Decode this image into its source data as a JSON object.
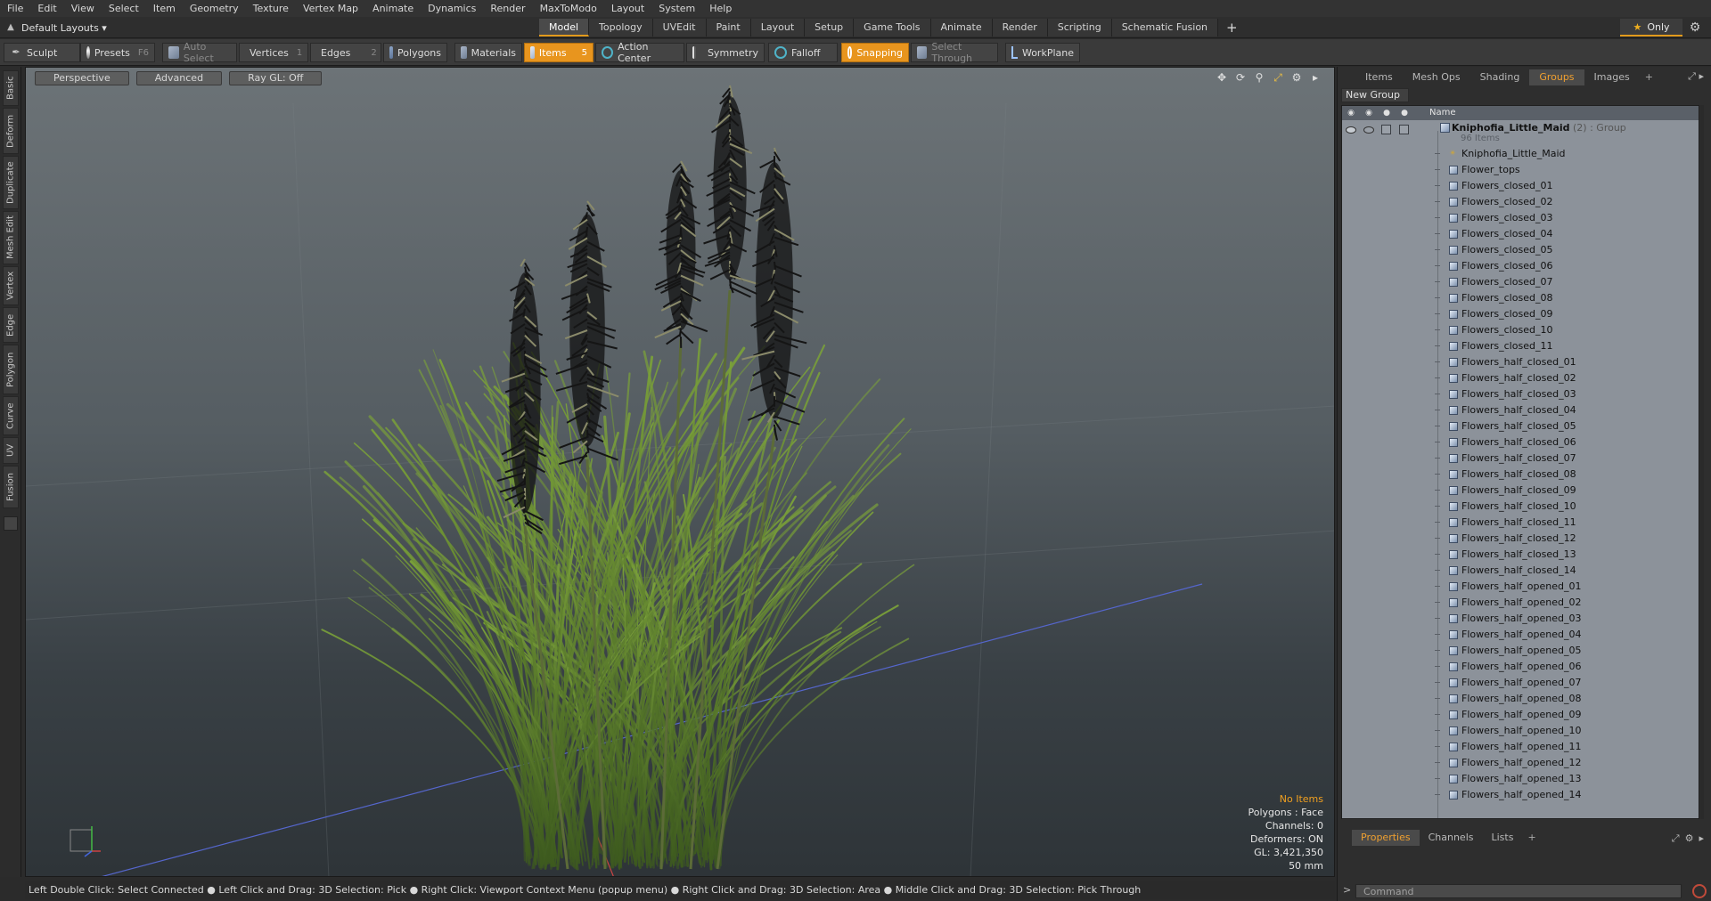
{
  "menubar": {
    "items": [
      "File",
      "Edit",
      "View",
      "Select",
      "Item",
      "Geometry",
      "Texture",
      "Vertex Map",
      "Animate",
      "Dynamics",
      "Render",
      "MaxToModo",
      "Layout",
      "System",
      "Help"
    ]
  },
  "layoutbar": {
    "layout_label": "Default Layouts ▾",
    "tabs": [
      "Model",
      "Topology",
      "UVEdit",
      "Paint",
      "Layout",
      "Setup",
      "Game Tools",
      "Animate",
      "Render",
      "Scripting",
      "Schematic Fusion"
    ],
    "active_tab": "Model",
    "plus": "+",
    "only_label": "Only"
  },
  "toolbar": {
    "sculpt": "Sculpt",
    "presets": "Presets",
    "presets_key": "F6",
    "auto_select": "Auto Select",
    "vertices": "Vertices",
    "vertices_count": "1",
    "edges": "Edges",
    "edges_count": "2",
    "polygons": "Polygons",
    "materials": "Materials",
    "items": "Items",
    "items_count": "5",
    "action_center": "Action Center",
    "symmetry": "Symmetry",
    "falloff": "Falloff",
    "snapping": "Snapping",
    "select_through": "Select Through",
    "workplane": "WorkPlane"
  },
  "lefttabs": [
    "Basic",
    "Deform",
    "Duplicate",
    "Mesh Edit",
    "Vertex",
    "Edge",
    "Polygon",
    "Curve",
    "UV",
    "Fusion"
  ],
  "viewport": {
    "tabs": [
      "Perspective",
      "Advanced",
      "Ray GL: Off"
    ],
    "stats": {
      "no_items": "No Items",
      "polygons": "Polygons : Face",
      "channels": "Channels: 0",
      "deformers": "Deformers: ON",
      "gl": "GL: 3,421,350",
      "focal": "50 mm"
    }
  },
  "statusbar": "Left Double Click: Select Connected ● Left Click and Drag: 3D Selection: Pick ● Right Click: Viewport Context Menu (popup menu) ● Right Click and Drag: 3D Selection: Area ● Middle Click and Drag: 3D Selection: Pick Through",
  "rightpanel": {
    "tabs": [
      "Items",
      "Mesh Ops",
      "Shading",
      "Groups",
      "Images"
    ],
    "active_tab": "Groups",
    "plus": "+",
    "new_group": "New Group",
    "column_name": "Name",
    "group": {
      "name": "Kniphofia_Little_Maid",
      "meta": " (2) : Group",
      "count": "96 Items"
    },
    "items": [
      "Kniphofia_Little_Maid",
      "Flower_tops",
      "Flowers_closed_01",
      "Flowers_closed_02",
      "Flowers_closed_03",
      "Flowers_closed_04",
      "Flowers_closed_05",
      "Flowers_closed_06",
      "Flowers_closed_07",
      "Flowers_closed_08",
      "Flowers_closed_09",
      "Flowers_closed_10",
      "Flowers_closed_11",
      "Flowers_half_closed_01",
      "Flowers_half_closed_02",
      "Flowers_half_closed_03",
      "Flowers_half_closed_04",
      "Flowers_half_closed_05",
      "Flowers_half_closed_06",
      "Flowers_half_closed_07",
      "Flowers_half_closed_08",
      "Flowers_half_closed_09",
      "Flowers_half_closed_10",
      "Flowers_half_closed_11",
      "Flowers_half_closed_12",
      "Flowers_half_closed_13",
      "Flowers_half_closed_14",
      "Flowers_half_opened_01",
      "Flowers_half_opened_02",
      "Flowers_half_opened_03",
      "Flowers_half_opened_04",
      "Flowers_half_opened_05",
      "Flowers_half_opened_06",
      "Flowers_half_opened_07",
      "Flowers_half_opened_08",
      "Flowers_half_opened_09",
      "Flowers_half_opened_10",
      "Flowers_half_opened_11",
      "Flowers_half_opened_12",
      "Flowers_half_opened_13",
      "Flowers_half_opened_14"
    ],
    "bottom_tabs": [
      "Properties",
      "Channels",
      "Lists"
    ],
    "bottom_active": "Properties",
    "command_placeholder": "Command"
  },
  "colors": {
    "accent": "#e8951e",
    "panel_bg": "#2e2e2e",
    "list_bg": "#8c929a"
  }
}
